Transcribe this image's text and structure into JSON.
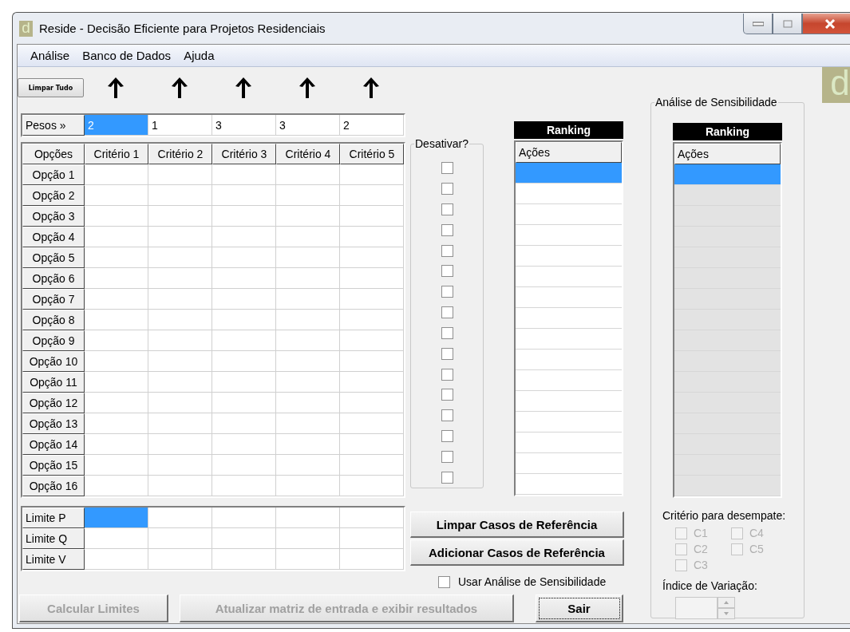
{
  "window": {
    "icon": "d",
    "title": "Reside - Decisão Eficiente para Projetos Residenciais"
  },
  "menu": [
    {
      "label": "Análise"
    },
    {
      "label": "Banco de Dados"
    },
    {
      "label": "Ajuda"
    }
  ],
  "clear_all_button": "Limpar Tudo",
  "weights_label": "Pesos »",
  "options_header": "Opções",
  "criteria": [
    {
      "label": "Critério 1",
      "weight": "2",
      "selected": true
    },
    {
      "label": "Critério 2",
      "weight": "1",
      "selected": false
    },
    {
      "label": "Critério 3",
      "weight": "3",
      "selected": false
    },
    {
      "label": "Critério 4",
      "weight": "3",
      "selected": false
    },
    {
      "label": "Critério 5",
      "weight": "2",
      "selected": false
    }
  ],
  "options": [
    {
      "label": "Opção 1",
      "deactivated": false
    },
    {
      "label": "Opção 2",
      "deactivated": false
    },
    {
      "label": "Opção 3",
      "deactivated": false
    },
    {
      "label": "Opção 4",
      "deactivated": false
    },
    {
      "label": "Opção 5",
      "deactivated": false
    },
    {
      "label": "Opção 6",
      "deactivated": false
    },
    {
      "label": "Opção 7",
      "deactivated": false
    },
    {
      "label": "Opção 8",
      "deactivated": false
    },
    {
      "label": "Opção 9",
      "deactivated": false
    },
    {
      "label": "Opção 10",
      "deactivated": false
    },
    {
      "label": "Opção 11",
      "deactivated": false
    },
    {
      "label": "Opção 12",
      "deactivated": false
    },
    {
      "label": "Opção 13",
      "deactivated": false
    },
    {
      "label": "Opção 14",
      "deactivated": false
    },
    {
      "label": "Opção 15",
      "deactivated": false
    },
    {
      "label": "Opção 16",
      "deactivated": false
    }
  ],
  "deactivate_label": "Desativar?",
  "ranking": {
    "title": "Ranking",
    "column": "Ações",
    "disabled": false,
    "rows": [
      {
        "selected": true
      },
      {
        "selected": false
      },
      {
        "selected": false
      },
      {
        "selected": false
      },
      {
        "selected": false
      },
      {
        "selected": false
      },
      {
        "selected": false
      },
      {
        "selected": false
      },
      {
        "selected": false
      },
      {
        "selected": false
      },
      {
        "selected": false
      },
      {
        "selected": false
      },
      {
        "selected": false
      },
      {
        "selected": false
      },
      {
        "selected": false
      },
      {
        "selected": false
      }
    ]
  },
  "limits": [
    {
      "label": "Limite P",
      "cells": [
        {
          "selected": true
        },
        {
          "selected": false
        },
        {
          "selected": false
        },
        {
          "selected": false
        },
        {
          "selected": false
        }
      ]
    },
    {
      "label": "Limite Q",
      "cells": [
        {
          "selected": false
        },
        {
          "selected": false
        },
        {
          "selected": false
        },
        {
          "selected": false
        },
        {
          "selected": false
        }
      ]
    },
    {
      "label": "Limite V",
      "cells": [
        {
          "selected": false
        },
        {
          "selected": false
        },
        {
          "selected": false
        },
        {
          "selected": false
        },
        {
          "selected": false
        }
      ]
    }
  ],
  "reference_buttons": [
    {
      "label": "Limpar Casos de Referência"
    },
    {
      "label": "Adicionar Casos de Referência"
    }
  ],
  "use_sensitivity": {
    "label": "Usar Análise de Sensibilidade",
    "checked": false
  },
  "bottom_buttons": [
    {
      "label": "Calcular Limites",
      "disabled": true,
      "focused": false
    },
    {
      "label": "Atualizar matriz de entrada e exibir resultados",
      "disabled": true,
      "focused": false
    },
    {
      "label": "Sair",
      "disabled": false,
      "focused": true
    }
  ],
  "sensitivity": {
    "title": "Análise de Sensibilidade",
    "ranking": {
      "title": "Ranking",
      "column": "Ações",
      "disabled": true,
      "rows": [
        {
          "selected": true
        },
        {
          "selected": false
        },
        {
          "selected": false
        },
        {
          "selected": false
        },
        {
          "selected": false
        },
        {
          "selected": false
        },
        {
          "selected": false
        },
        {
          "selected": false
        },
        {
          "selected": false
        },
        {
          "selected": false
        },
        {
          "selected": false
        },
        {
          "selected": false
        },
        {
          "selected": false
        },
        {
          "selected": false
        },
        {
          "selected": false
        },
        {
          "selected": false
        }
      ]
    },
    "tiebreak_label": "Critério para desempate:",
    "tiebreak": [
      {
        "label": "C1",
        "checked": false,
        "disabled": true
      },
      {
        "label": "C2",
        "checked": false,
        "disabled": true
      },
      {
        "label": "C3",
        "checked": false,
        "disabled": true
      },
      {
        "label": "C4",
        "checked": false,
        "disabled": true
      },
      {
        "label": "C5",
        "checked": false,
        "disabled": true
      }
    ],
    "variation_label": "Índice de Variação:",
    "variation_disabled": true
  },
  "logo": "d"
}
